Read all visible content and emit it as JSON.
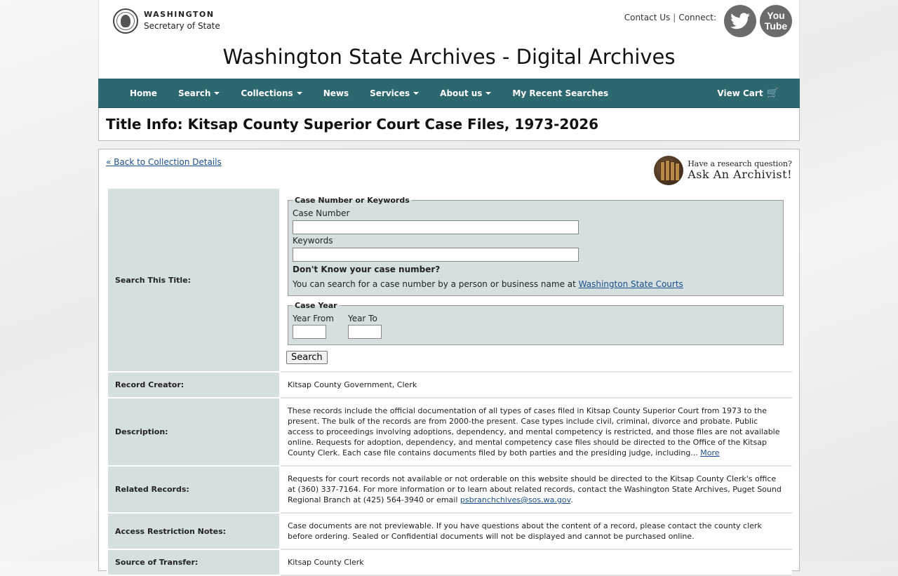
{
  "header": {
    "logo_line1": "WASHINGTON",
    "logo_line2": "Secretary of State",
    "contact_link": "Contact Us",
    "separator": "|",
    "connect_label": "Connect:",
    "youtube_line1": "You",
    "youtube_line2": "Tube",
    "site_title": "Washington State Archives - Digital Archives"
  },
  "nav": {
    "items": [
      {
        "label": "Home",
        "dropdown": false
      },
      {
        "label": "Search",
        "dropdown": true
      },
      {
        "label": "Collections",
        "dropdown": true
      },
      {
        "label": "News",
        "dropdown": false
      },
      {
        "label": "Services",
        "dropdown": true
      },
      {
        "label": "About us",
        "dropdown": true
      },
      {
        "label": "My Recent Searches",
        "dropdown": false
      }
    ],
    "cart_label": "View Cart",
    "cart_icon": "🛒"
  },
  "page": {
    "title": "Title Info: Kitsap County Superior Court Case Files, 1973-2026",
    "back_link": "« Back to Collection Details",
    "ask_question": "Have a research question?",
    "ask_archivist": "Ask An Archivist!"
  },
  "search_form": {
    "label": "Search This Title:",
    "case_legend": "Case Number or Keywords",
    "case_number_label": "Case Number",
    "case_number_value": "",
    "keywords_label": "Keywords",
    "keywords_value": "",
    "dont_know": "Don't Know your case number?",
    "hint_text": "You can search for a case number by a person or business name at ",
    "hint_link": "Washington State Courts",
    "year_legend": "Case Year",
    "year_from_label": "Year From",
    "year_from_value": "",
    "year_to_label": "Year To",
    "year_to_value": "",
    "search_button": "Search"
  },
  "rows": {
    "creator_label": "Record Creator:",
    "creator_value": "Kitsap County Government, Clerk",
    "description_label": "Description:",
    "description_value": "These records include the official documentation of all types of cases filed in Kitsap County Superior Court from 1973 to the present. The bulk of the records are from 2000-the present. Case types include civil, criminal, divorce and probate. Public access to proceedings involving adoptions, dependency, and mental competency is restricted, and those files are not available online. Requests for adoption, dependency, and mental competency case files should be directed to the Office of the Kitsap County Clerk. Each case file contains documents filed by both parties and the presiding judge, including... ",
    "description_more": "More",
    "related_label": "Related Records:",
    "related_value": "Requests for court records not available or not orderable on this website should be directed to the Kitsap County Clerk's office at (360) 337-7164. For more information or to learn about related records, contact the Washington State Archives, Puget Sound Regional Branch at (425) 564-3940 or email ",
    "related_email": "psbranchchives@sos.wa.gov",
    "related_end": ".",
    "access_label": "Access Restriction Notes:",
    "access_value": "Case documents are not previewable. If you have questions about the content of a record, please contact the county clerk before ordering. Sealed or Confidential documents will not be displayed and cannot be purchased online.",
    "source_label": "Source of Transfer:",
    "source_value": "Kitsap County Clerk"
  }
}
